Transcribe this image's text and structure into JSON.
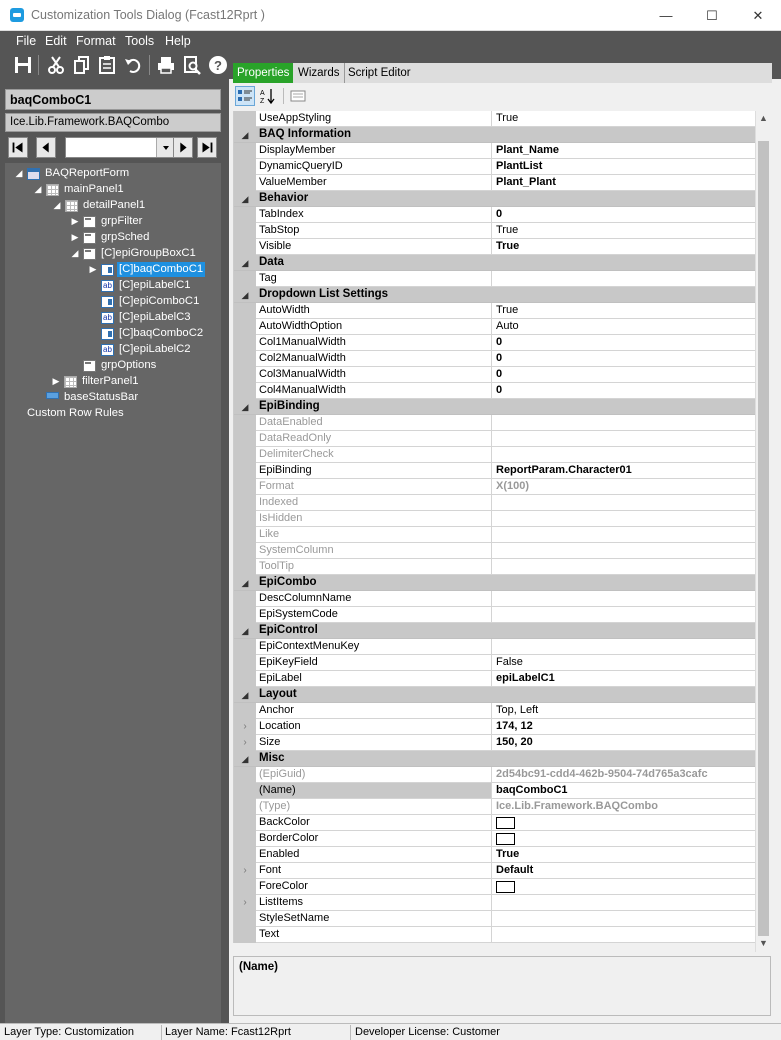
{
  "window": {
    "title": "Customization Tools Dialog  (Fcast12Rprt )",
    "minimize": "—",
    "maximize": "☐",
    "close": "✕"
  },
  "menu": [
    "File",
    "Edit",
    "Format",
    "Tools",
    "Help"
  ],
  "tabs": [
    "Properties",
    "Wizards",
    "Script Editor"
  ],
  "left": {
    "control_name": "baqComboC1",
    "control_type": "Ice.Lib.Framework.BAQCombo",
    "tree": [
      {
        "label": "BAQReportForm",
        "icon": "form-icon",
        "expand": "◢"
      },
      {
        "label": "mainPanel1",
        "icon": "panel-icon",
        "expand": "◢"
      },
      {
        "label": "detailPanel1",
        "icon": "panel-icon",
        "expand": "◢"
      },
      {
        "label": "grpFilter",
        "icon": "group-icon",
        "expand": "▶"
      },
      {
        "label": "grpSched",
        "icon": "group-icon",
        "expand": "▶"
      },
      {
        "label": "[C]epiGroupBoxC1",
        "icon": "group-icon",
        "expand": "◢"
      },
      {
        "label": "[C]baqComboC1",
        "icon": "combo-icon",
        "expand": "▶"
      },
      {
        "label": "[C]epiLabelC1",
        "icon": "label-icon",
        "expand": ""
      },
      {
        "label": "[C]epiComboC1",
        "icon": "combo-icon",
        "expand": ""
      },
      {
        "label": "[C]epiLabelC3",
        "icon": "label-icon",
        "expand": ""
      },
      {
        "label": "[C]baqComboC2",
        "icon": "combo-icon",
        "expand": ""
      },
      {
        "label": "[C]epiLabelC2",
        "icon": "label-icon",
        "expand": ""
      },
      {
        "label": "grpOptions",
        "icon": "group-icon",
        "expand": ""
      },
      {
        "label": "filterPanel1",
        "icon": "panel-icon",
        "expand": "▶"
      },
      {
        "label": "baseStatusBar",
        "icon": "statusbar-icon",
        "expand": ""
      },
      {
        "label": "Custom Row Rules",
        "icon": "",
        "expand": ""
      }
    ]
  },
  "properties": [
    {
      "t": "row",
      "name": "UseAppStyling",
      "value": "True"
    },
    {
      "t": "cat",
      "name": "BAQ Information"
    },
    {
      "t": "row",
      "name": "DisplayMember",
      "value": "Plant_Name",
      "bold": true
    },
    {
      "t": "row",
      "name": "DynamicQueryID",
      "value": "PlantList",
      "bold": true
    },
    {
      "t": "row",
      "name": "ValueMember",
      "value": "Plant_Plant",
      "bold": true
    },
    {
      "t": "cat",
      "name": "Behavior"
    },
    {
      "t": "row",
      "name": "TabIndex",
      "value": "0",
      "bold": true
    },
    {
      "t": "row",
      "name": "TabStop",
      "value": "True"
    },
    {
      "t": "row",
      "name": "Visible",
      "value": "True",
      "bold": true
    },
    {
      "t": "cat",
      "name": "Data"
    },
    {
      "t": "row",
      "name": "Tag",
      "value": ""
    },
    {
      "t": "cat",
      "name": "Dropdown List Settings"
    },
    {
      "t": "row",
      "name": "AutoWidth",
      "value": "True"
    },
    {
      "t": "row",
      "name": "AutoWidthOption",
      "value": "Auto"
    },
    {
      "t": "row",
      "name": "Col1ManualWidth",
      "value": "0",
      "bold": true
    },
    {
      "t": "row",
      "name": "Col2ManualWidth",
      "value": "0",
      "bold": true
    },
    {
      "t": "row",
      "name": "Col3ManualWidth",
      "value": "0",
      "bold": true
    },
    {
      "t": "row",
      "name": "Col4ManualWidth",
      "value": "0",
      "bold": true
    },
    {
      "t": "cat",
      "name": "EpiBinding"
    },
    {
      "t": "row",
      "name": "DataEnabled",
      "value": "",
      "dis": true
    },
    {
      "t": "row",
      "name": "DataReadOnly",
      "value": "",
      "dis": true
    },
    {
      "t": "row",
      "name": "DelimiterCheck",
      "value": "",
      "dis": true
    },
    {
      "t": "row",
      "name": "EpiBinding",
      "value": "ReportParam.Character01",
      "bold": true
    },
    {
      "t": "row",
      "name": "Format",
      "value": "X(100)",
      "bold": true,
      "dis": true
    },
    {
      "t": "row",
      "name": "Indexed",
      "value": "",
      "dis": true
    },
    {
      "t": "row",
      "name": "IsHidden",
      "value": "",
      "dis": true
    },
    {
      "t": "row",
      "name": "Like",
      "value": "",
      "dis": true
    },
    {
      "t": "row",
      "name": "SystemColumn",
      "value": "",
      "dis": true
    },
    {
      "t": "row",
      "name": "ToolTip",
      "value": "",
      "dis": true
    },
    {
      "t": "cat",
      "name": "EpiCombo"
    },
    {
      "t": "row",
      "name": "DescColumnName",
      "value": ""
    },
    {
      "t": "row",
      "name": "EpiSystemCode",
      "value": ""
    },
    {
      "t": "cat",
      "name": "EpiControl"
    },
    {
      "t": "row",
      "name": "EpiContextMenuKey",
      "value": ""
    },
    {
      "t": "row",
      "name": "EpiKeyField",
      "value": "False"
    },
    {
      "t": "row",
      "name": "EpiLabel",
      "value": "epiLabelC1",
      "bold": true
    },
    {
      "t": "cat",
      "name": "Layout"
    },
    {
      "t": "row",
      "name": "Anchor",
      "value": "Top, Left"
    },
    {
      "t": "row",
      "name": "Location",
      "value": "174, 12",
      "bold": true,
      "exp": true
    },
    {
      "t": "row",
      "name": "Size",
      "value": "150, 20",
      "bold": true,
      "exp": true
    },
    {
      "t": "cat",
      "name": "Misc"
    },
    {
      "t": "row",
      "name": "(EpiGuid)",
      "value": "2d54bc91-cdd4-462b-9504-74d765a3cafc",
      "bold": true,
      "dis": true
    },
    {
      "t": "row",
      "name": "(Name)",
      "value": "baqComboC1",
      "bold": true,
      "hl": true
    },
    {
      "t": "row",
      "name": "(Type)",
      "value": "Ice.Lib.Framework.BAQCombo",
      "bold": true,
      "dis": true
    },
    {
      "t": "row",
      "name": "BackColor",
      "value": "",
      "swatch": true
    },
    {
      "t": "row",
      "name": "BorderColor",
      "value": "",
      "swatch": true
    },
    {
      "t": "row",
      "name": "Enabled",
      "value": "True",
      "bold": true
    },
    {
      "t": "row",
      "name": "Font",
      "value": "Default",
      "bold": true,
      "exp": true
    },
    {
      "t": "row",
      "name": "ForeColor",
      "value": "",
      "swatch": true
    },
    {
      "t": "row",
      "name": "ListItems",
      "value": "",
      "exp": true
    },
    {
      "t": "row",
      "name": "StyleSetName",
      "value": ""
    },
    {
      "t": "row",
      "name": "Text",
      "value": ""
    }
  ],
  "description": {
    "title": "(Name)"
  },
  "status": {
    "layer_type": "Layer Type:  Customization",
    "layer_name": "Layer Name:  Fcast12Rprt",
    "license": "Developer License:  Customer"
  }
}
